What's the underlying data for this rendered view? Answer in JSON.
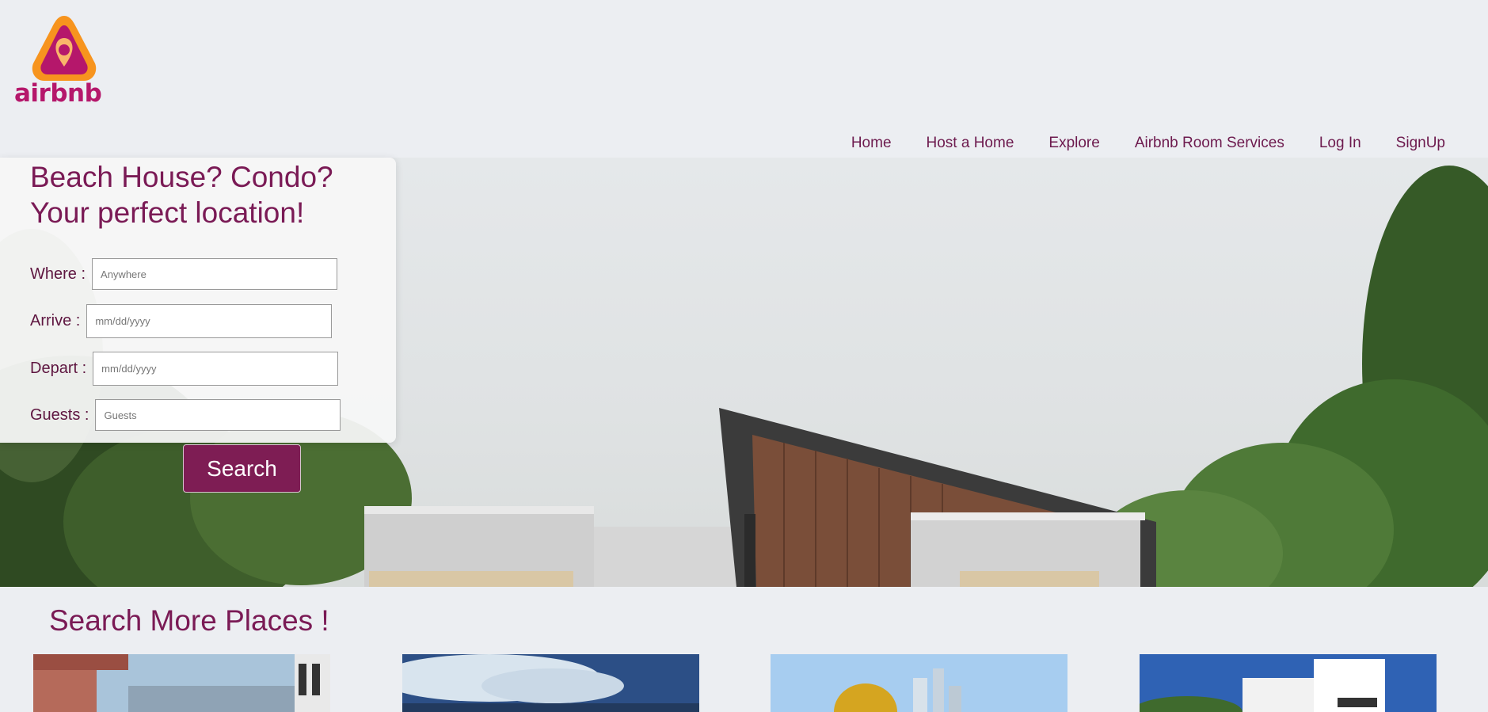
{
  "brand": {
    "logo_text": "airbnb",
    "logo_icon": "airbnb-logo-icon",
    "accent": "#7e1d54",
    "logo_orange": "#f7941e",
    "logo_magenta": "#b5176b"
  },
  "nav": {
    "items": [
      {
        "label": "Home"
      },
      {
        "label": "Host a Home"
      },
      {
        "label": "Explore"
      },
      {
        "label": "Airbnb Room Services"
      },
      {
        "label": "Log In"
      },
      {
        "label": "SignUp"
      }
    ]
  },
  "search": {
    "title_line1": "Beach House? Condo?",
    "title_line2": "Your perfect location!",
    "where_label": "Where :",
    "where_placeholder": "Anywhere",
    "arrive_label": "Arrive :",
    "arrive_placeholder": "mm/dd/yyyy",
    "depart_label": "Depart :",
    "depart_placeholder": "mm/dd/yyyy",
    "guests_label": "Guests :",
    "guests_placeholder": "Guests",
    "button_label": "Search"
  },
  "more_places": {
    "title": "Search More Places !",
    "thumbnails": [
      "place-thumbnail-1",
      "place-thumbnail-2",
      "place-thumbnail-3",
      "place-thumbnail-4"
    ]
  }
}
